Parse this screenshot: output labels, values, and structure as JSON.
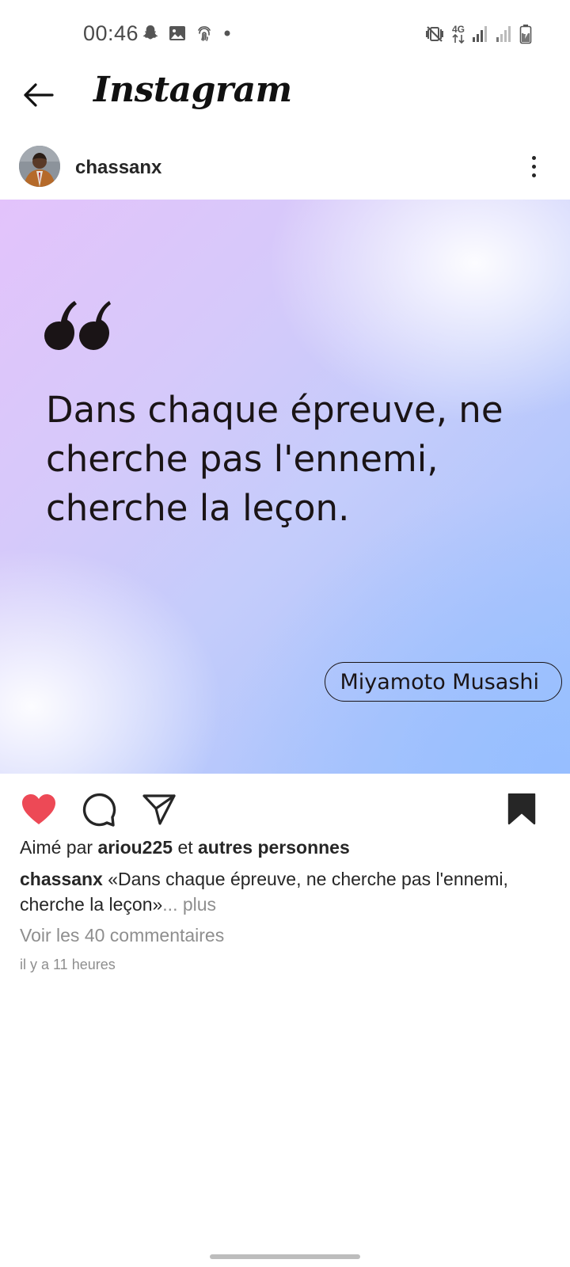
{
  "status_bar": {
    "time": "00:46",
    "left_icons": [
      "snapchat-icon",
      "gallery-icon",
      "fingerprint-icon",
      "dot-icon"
    ],
    "right_icons": [
      "mute-vibrate-icon",
      "4g-data-icon",
      "signal-icon",
      "signal-icon",
      "battery-icon"
    ],
    "network_label": "4G"
  },
  "header": {
    "title": "Instagram"
  },
  "post": {
    "author": "chassanx",
    "quote": "Dans chaque épreuve, ne cherche pas l'ennemi, cherche la leçon.",
    "quote_author": "Miyamoto Musashi",
    "liked": true,
    "saved": true,
    "colors": {
      "like": "#ed4956",
      "text": "#262626",
      "muted": "#8e8e8e"
    }
  },
  "likes": {
    "prefix": "Aimé par",
    "user": "ariou225",
    "connector": "et",
    "others": "autres personnes"
  },
  "caption": {
    "user": "chassanx",
    "text": "«Dans chaque épreuve, ne cherche pas l'ennemi, cherche la leçon»",
    "more_ellipsis": "...",
    "more_label": "plus"
  },
  "comments": {
    "label": "Voir les 40 commentaires"
  },
  "timestamp": "il y a 11 heures"
}
